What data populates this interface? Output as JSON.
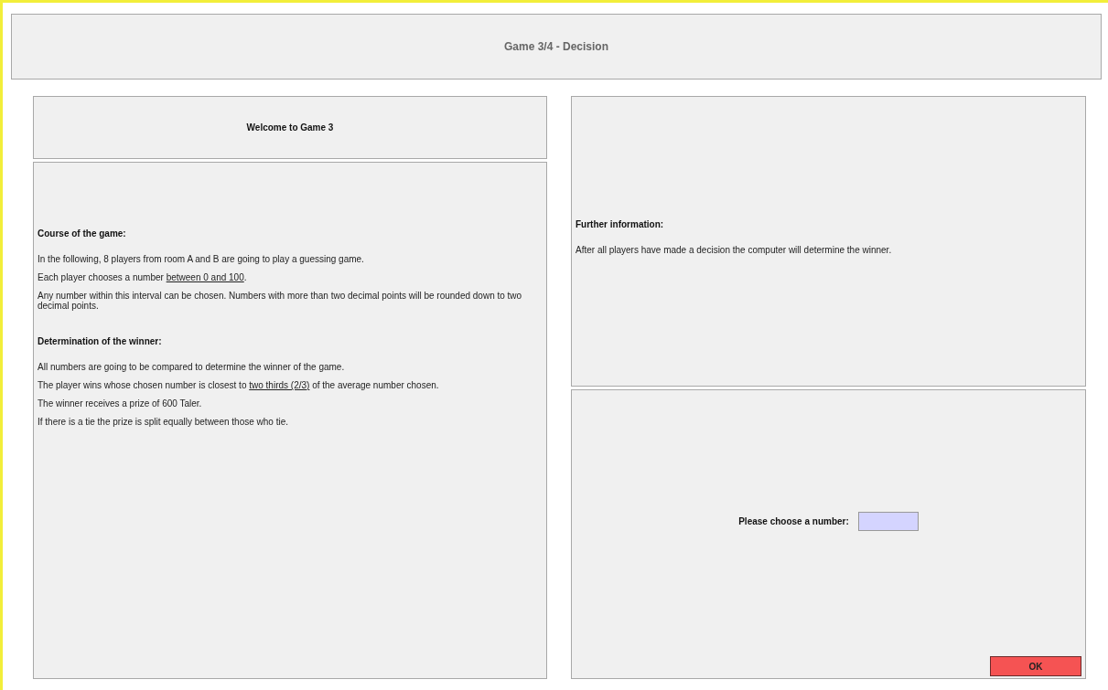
{
  "header": {
    "title": "Game 3/4 - Decision"
  },
  "instructions": {
    "title": "Welcome to Game 3",
    "sections": [
      {
        "heading": "Course of the game:",
        "paragraphs": [
          [
            {
              "text": "In the following, 8 players from room A and B are going to play a guessing game.",
              "underline": false
            }
          ],
          [
            {
              "text": "Each player chooses a number ",
              "underline": false
            },
            {
              "text": "between 0 and 100",
              "underline": true
            },
            {
              "text": ".",
              "underline": false
            }
          ],
          [
            {
              "text": "Any number within this interval can be chosen. Numbers with more than two decimal points will be rounded down to two decimal points.",
              "underline": false
            }
          ]
        ]
      },
      {
        "heading": "Determination of the winner:",
        "paragraphs": [
          [
            {
              "text": "All numbers are going to be compared to determine the winner of the game.",
              "underline": false
            }
          ],
          [
            {
              "text": "The player wins whose chosen number is closest to ",
              "underline": false
            },
            {
              "text": "two thirds (2/3)",
              "underline": true
            },
            {
              "text": " of the average number chosen.",
              "underline": false
            }
          ],
          [
            {
              "text": "The winner receives a prize of 600 Taler.",
              "underline": false
            }
          ],
          [
            {
              "text": "If there is a tie the prize is split equally between those who tie.",
              "underline": false
            }
          ]
        ]
      }
    ]
  },
  "info": {
    "heading": "Further information:",
    "text": "After all players have made a decision the computer will determine the winner."
  },
  "decision": {
    "label": "Please choose a number:",
    "button": "OK"
  }
}
